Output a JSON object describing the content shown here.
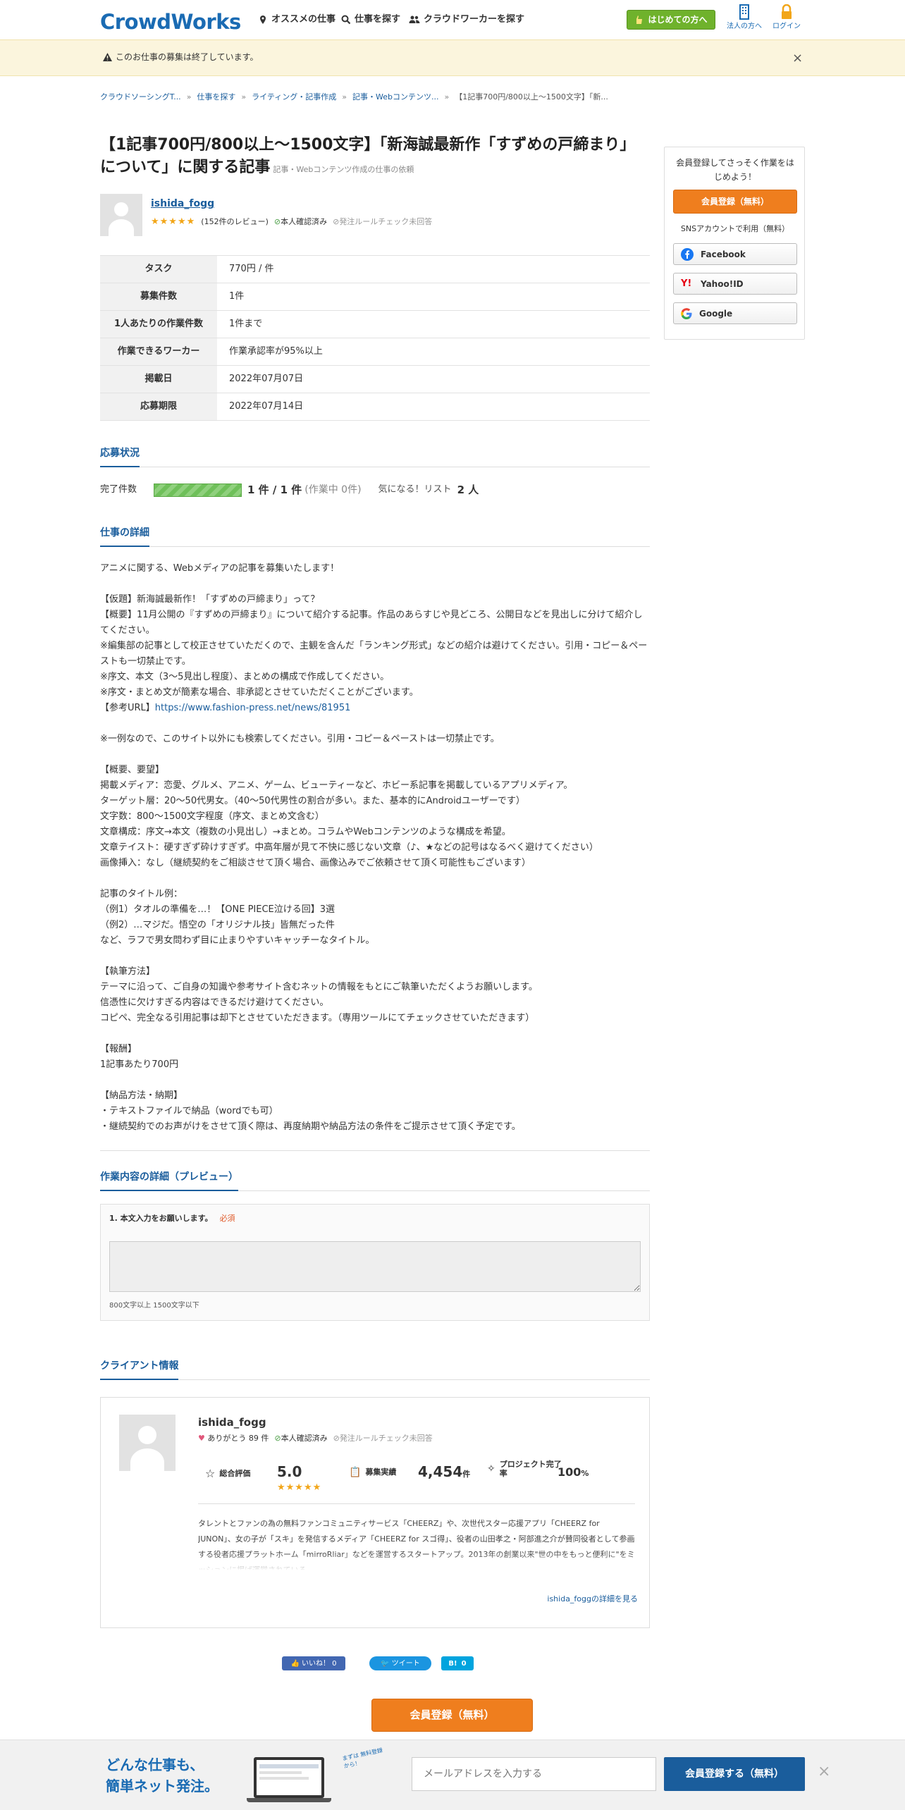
{
  "header": {
    "logo": "CrowdWorks",
    "nav": [
      "オススメの仕事",
      "仕事を探す",
      "クラウドワーカーを探す"
    ],
    "beginner_button": "はじめての方へ",
    "corporate_label": "法人の方へ",
    "login_label": "ログイン"
  },
  "alert": {
    "text": "このお仕事の募集は終了しています。",
    "close": "×"
  },
  "breadcrumb": [
    "クラウドソーシングT...",
    "仕事を探す",
    "ライティング・記事作成",
    "記事・Webコンテンツ...",
    "【1記事700円/800以上〜1500文字】「新..."
  ],
  "job": {
    "title": "【1記事700円/800以上〜1500文字】「新海誠最新作「すずめの戸締まり」について」に関する記事",
    "subtitle": "記事・Webコンテンツ作成の仕事の依頼",
    "client_name": "ishida_fogg",
    "stars": "★★★★★",
    "reviews": "(152件のレビュー)",
    "verified": "本人確認済み",
    "rule_check": "発注ルールチェック未回答"
  },
  "info_table": [
    {
      "key": "タスク",
      "value": "770円 / 件"
    },
    {
      "key": "募集件数",
      "value": "1件"
    },
    {
      "key": "1人あたりの作業件数",
      "value": "1件まで"
    },
    {
      "key": "作業できるワーカー",
      "value": "作業承認率が95%以上"
    },
    {
      "key": "掲載日",
      "value": "2022年07月07日"
    },
    {
      "key": "応募期限",
      "value": "2022年07月14日"
    }
  ],
  "application": {
    "section_title": "応募状況",
    "label": "完了件数",
    "progress_fraction": 1.0,
    "count": "1 件 / 1 件",
    "in_progress": "(作業中 0件)",
    "watch_label": "気になる！リスト",
    "watch_count": "2 人"
  },
  "details": {
    "section_title": "仕事の詳細",
    "lines": [
      "アニメに関する、Webメディアの記事を募集いたします！",
      "",
      "【仮題】新海誠最新作！「すずめの戸締まり」って？",
      "【概要】11月公開の『すずめの戸締まり』について紹介する記事。作品のあらすじや見どころ、公開日などを見出しに分けて紹介してください。",
      "※編集部の記事として校正させていただくので、主観を含んだ「ランキング形式」などの紹介は避けてください。引用・コピー＆ペーストも一切禁止です。",
      "※序文、本文（3～5見出し程度）、まとめの構成で作成してください。",
      "※序文・まとめ文が簡素な場合、非承認とさせていただくことがございます。",
      "【参考URL】",
      "",
      "※一例なので、このサイト以外にも検索してください。引用・コピー＆ペーストは一切禁止です。",
      "",
      "【概要、要望】",
      "掲載メディア：恋愛、グルメ、アニメ、ゲーム、ビューティーなど、ホビー系記事を掲載しているアプリメディア。",
      "ターゲット層：20〜50代男女。（40〜50代男性の割合が多い。また、基本的にAndroidユーザーです）",
      "文字数：800〜1500文字程度（序文、まとめ文含む）",
      "文章構成：序文→本文（複数の小見出し）→まとめ。コラムやWebコンテンツのような構成を希望。",
      "文章テイスト：硬すぎず砕けすぎず。中高年層が見て不快に感じない文章（♪、★などの記号はなるべく避けてください）",
      "画像挿入：なし（継続契約をご相談させて頂く場合、画像込みでご依頼させて頂く可能性もございます）",
      "",
      "記事のタイトル例：",
      "（例1）タオルの準備を…！【ONE PIECE泣ける回】3選",
      "（例2）…マジだ。悟空の「オリジナル技」皆無だった件",
      "など、ラフで男女問わず目に止まりやすいキャッチーなタイトル。",
      "",
      "【執筆方法】",
      "テーマに沿って、ご自身の知識や参考サイト含むネットの情報をもとにご執筆いただくようお願いします。",
      "信憑性に欠けすぎる内容はできるだけ避けてください。",
      "コピペ、完全なる引用記事は却下とさせていただきます。（専用ツールにてチェックさせていただきます）",
      "",
      "【報酬】",
      "1記事あたり700円",
      "",
      "【納品方法・納期】",
      "・テキストファイルで納品（wordでも可）",
      "・継続契約でのお声がけをさせて頂く際は、再度納期や納品方法の条件をご提示させて頂く予定です。"
    ],
    "ref_url": "https://www.fashion-press.net/news/81951"
  },
  "preview": {
    "section_title": "作業内容の詳細（プレビュー）",
    "question": "1. 本文入力をお願いします。",
    "required": "必須",
    "hint": "800文字以上 1500文字以下"
  },
  "client_info": {
    "section_title": "クライアント情報",
    "name": "ishida_fogg",
    "thanks": "ありがとう 89 件",
    "verified": "本人確認済み",
    "rule_check": "発注ルールチェック未回答",
    "rating_label": "総合評価",
    "rating_value": "5.0",
    "rating_stars": "★★★★★",
    "results_label": "募集実績",
    "results_value": "4,454",
    "results_unit": "件",
    "completion_label": "プロジェクト完了率",
    "completion_value": "100",
    "completion_unit": "%",
    "description": "タレントとファンの為の無料ファンコミュニティサービス「CHEERZ」や、次世代スター応援アプリ「CHEERZ for JUNON」、女の子が「スキ」を発信するメディア「CHEERZ for スゴ得」、役者の山田孝之・阿部進之介が賛同役者として参画する役者応援プラットホーム「mirroRliar」などを運営するスタートアップ。2013年の創業以来\"世の中をもっと便利に\"をミッションに掲げ運営されている。",
    "more_link": "ishida_foggの詳細を見る"
  },
  "share": {
    "like": "いいね！ 0",
    "tweet": "ツイート",
    "hatena": "0"
  },
  "register_cta": "会員登録（無料）",
  "side": {
    "lead": "会員登録してさっそく作業をはじめよう！",
    "register": "会員登録（無料）",
    "sns_label": "SNSアカウントで利用（無料）",
    "facebook": "Facebook",
    "yahoo": "Yahoo!ID",
    "google": "Google"
  },
  "footer": {
    "catch_line1": "どんな仕事も、",
    "catch_line2": "簡単ネット発注。",
    "bubble": "まずは 無料登録から！",
    "email_placeholder": "メールアドレスを入力する",
    "submit": "会員登録する（無料）",
    "close": "×"
  },
  "colors": {
    "brand_blue": "#1a6bb3",
    "orange": "#ef7e1e",
    "green": "#6fb22c",
    "star": "#f2a619"
  }
}
